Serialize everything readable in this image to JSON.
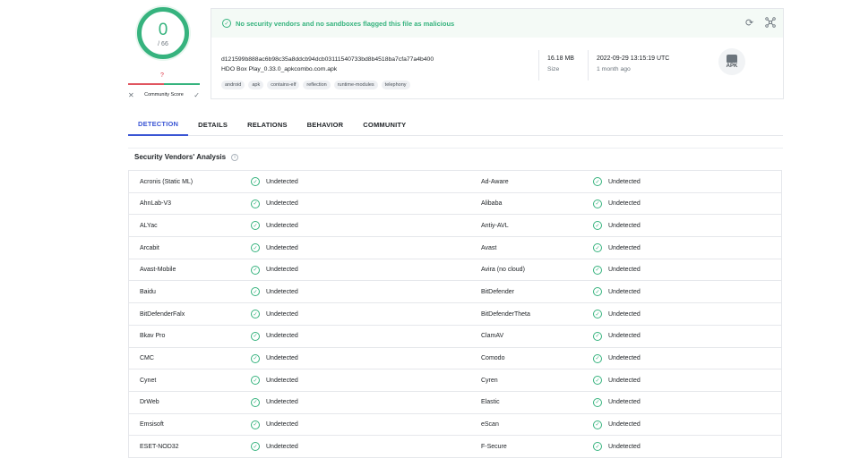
{
  "score": {
    "detections": "0",
    "total": "/ 66",
    "community_value": "?",
    "community_label": "Community Score"
  },
  "banner": {
    "message": "No security vendors and no sandboxes flagged this file as malicious"
  },
  "file": {
    "hash": "d121599b888ac6b98c35a8ddcb94dcb03111540733bd8b4518ba7cfa77a4b400",
    "name": "HDO Box Play_0.33.0_apkcombo.com.apk",
    "tags": [
      "android",
      "apk",
      "contains-elf",
      "reflection",
      "runtime-modules",
      "telephony"
    ],
    "size_value": "16.18 MB",
    "size_label": "Size",
    "date_value": "2022-09-29 13:15:19 UTC",
    "date_label": "1 month ago",
    "type_label": "APK"
  },
  "tabs": [
    "DETECTION",
    "DETAILS",
    "RELATIONS",
    "BEHAVIOR",
    "COMMUNITY"
  ],
  "section": {
    "title": "Security Vendors' Analysis",
    "info_icon": "i"
  },
  "vendors": [
    {
      "left": "Acronis (Static ML)",
      "left_result": "Undetected",
      "right": "Ad-Aware",
      "right_result": "Undetected"
    },
    {
      "left": "AhnLab-V3",
      "left_result": "Undetected",
      "right": "Alibaba",
      "right_result": "Undetected"
    },
    {
      "left": "ALYac",
      "left_result": "Undetected",
      "right": "Antiy-AVL",
      "right_result": "Undetected"
    },
    {
      "left": "Arcabit",
      "left_result": "Undetected",
      "right": "Avast",
      "right_result": "Undetected"
    },
    {
      "left": "Avast-Mobile",
      "left_result": "Undetected",
      "right": "Avira (no cloud)",
      "right_result": "Undetected"
    },
    {
      "left": "Baidu",
      "left_result": "Undetected",
      "right": "BitDefender",
      "right_result": "Undetected"
    },
    {
      "left": "BitDefenderFalx",
      "left_result": "Undetected",
      "right": "BitDefenderTheta",
      "right_result": "Undetected"
    },
    {
      "left": "Bkav Pro",
      "left_result": "Undetected",
      "right": "ClamAV",
      "right_result": "Undetected"
    },
    {
      "left": "CMC",
      "left_result": "Undetected",
      "right": "Comodo",
      "right_result": "Undetected"
    },
    {
      "left": "Cynet",
      "left_result": "Undetected",
      "right": "Cyren",
      "right_result": "Undetected"
    },
    {
      "left": "DrWeb",
      "left_result": "Undetected",
      "right": "Elastic",
      "right_result": "Undetected"
    },
    {
      "left": "Emsisoft",
      "left_result": "Undetected",
      "right": "eScan",
      "right_result": "Undetected"
    },
    {
      "left": "ESET-NOD32",
      "left_result": "Undetected",
      "right": "F-Secure",
      "right_result": "Undetected"
    }
  ],
  "colors": {
    "accent": "#3a55d4",
    "clean": "#36b37e",
    "malicious": "#e0555f"
  }
}
